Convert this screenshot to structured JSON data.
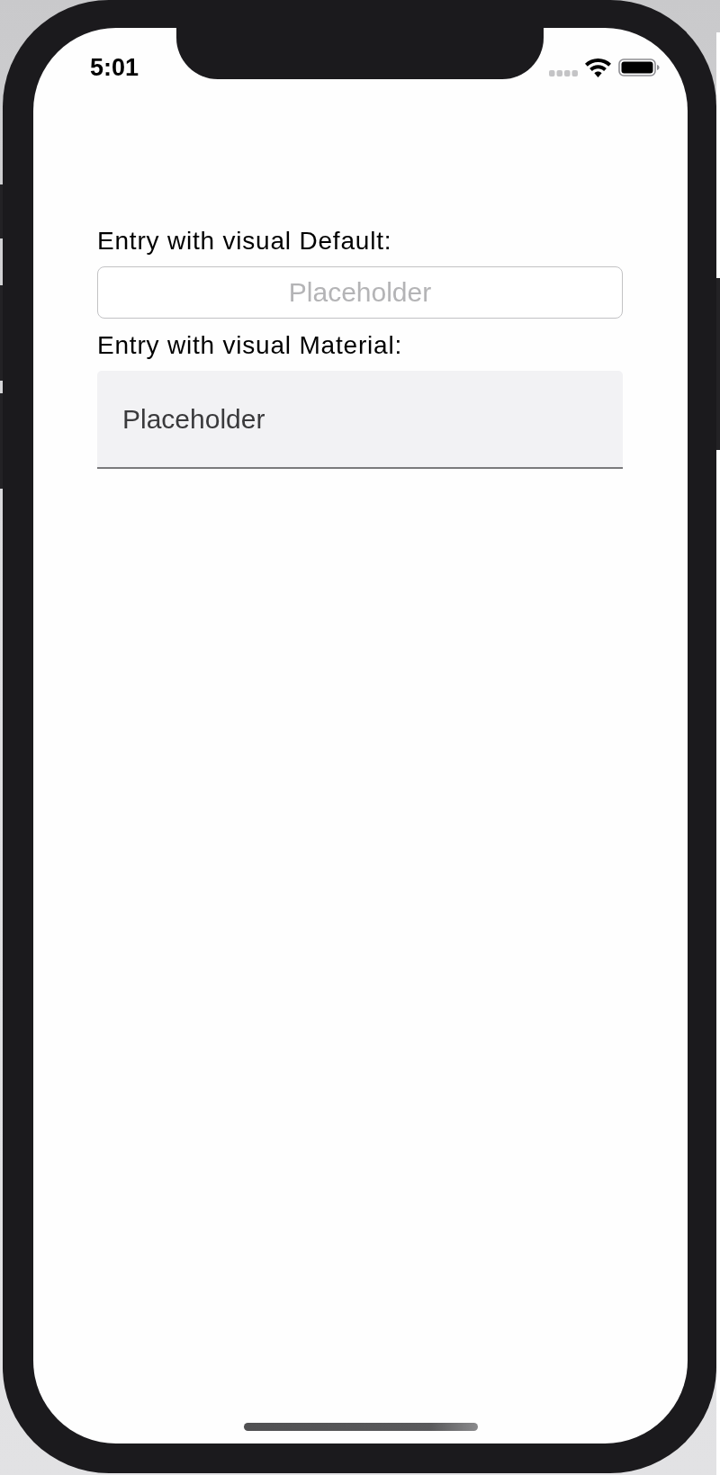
{
  "status_bar": {
    "time": "5:01"
  },
  "entries": [
    {
      "label": "Entry with visual Default:",
      "kind": "default",
      "placeholder": "Placeholder"
    },
    {
      "label": "Entry with visual Material:",
      "kind": "material",
      "placeholder": "Placeholder"
    }
  ]
}
